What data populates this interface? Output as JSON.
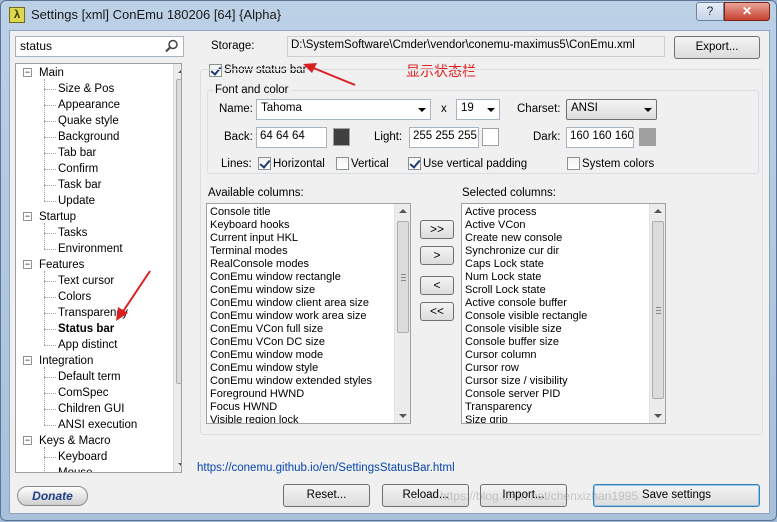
{
  "window": {
    "title": "Settings [xml] ConEmu 180206 [64] {Alpha}",
    "help_label": "?",
    "close_label": "✕"
  },
  "search": {
    "value": "status"
  },
  "tree": [
    {
      "label": "Main",
      "level": 0,
      "expander": "−"
    },
    {
      "label": "Size & Pos",
      "level": 1
    },
    {
      "label": "Appearance",
      "level": 1
    },
    {
      "label": "Quake style",
      "level": 1
    },
    {
      "label": "Background",
      "level": 1
    },
    {
      "label": "Tab bar",
      "level": 1
    },
    {
      "label": "Confirm",
      "level": 1
    },
    {
      "label": "Task bar",
      "level": 1
    },
    {
      "label": "Update",
      "level": 1
    },
    {
      "label": "Startup",
      "level": 0,
      "expander": "−"
    },
    {
      "label": "Tasks",
      "level": 1
    },
    {
      "label": "Environment",
      "level": 1
    },
    {
      "label": "Features",
      "level": 0,
      "expander": "−"
    },
    {
      "label": "Text cursor",
      "level": 1
    },
    {
      "label": "Colors",
      "level": 1
    },
    {
      "label": "Transparency",
      "level": 1
    },
    {
      "label": "Status bar",
      "level": 1,
      "selected": true
    },
    {
      "label": "App distinct",
      "level": 1
    },
    {
      "label": "Integration",
      "level": 0,
      "expander": "−"
    },
    {
      "label": "Default term",
      "level": 1
    },
    {
      "label": "ComSpec",
      "level": 1
    },
    {
      "label": "Children GUI",
      "level": 1
    },
    {
      "label": "ANSI execution",
      "level": 1
    },
    {
      "label": "Keys & Macro",
      "level": 0,
      "expander": "−"
    },
    {
      "label": "Keyboard",
      "level": 1
    },
    {
      "label": "Mouse",
      "level": 1
    }
  ],
  "storage": {
    "label": "Storage:",
    "path": "D:\\SystemSoftware\\Cmder\\vendor\\conemu-maximus5\\ConEmu.xml",
    "export_label": "Export..."
  },
  "status_bar": {
    "show_label": "Show status bar",
    "show_checked": true,
    "annotation": "显示状态栏"
  },
  "font_group": {
    "title": "Font and color",
    "name_label": "Name:",
    "name_value": "Tahoma",
    "x_label": "x",
    "size_value": "19",
    "charset_label": "Charset:",
    "charset_value": "ANSI",
    "back_label": "Back:",
    "back_value": "64 64 64",
    "back_color": "#404040",
    "light_label": "Light:",
    "light_value": "255 255 255",
    "light_color": "#ffffff",
    "dark_label": "Dark:",
    "dark_value": "160 160 160",
    "dark_color": "#a0a0a0",
    "lines_label": "Lines:",
    "horizontal_label": "Horizontal",
    "horizontal_checked": true,
    "vertical_label": "Vertical",
    "vertical_checked": false,
    "vpad_label": "Use vertical padding",
    "vpad_checked": true,
    "syscolors_label": "System colors",
    "syscolors_checked": false
  },
  "available": {
    "label": "Available columns:",
    "items": [
      "Console title",
      "Keyboard hooks",
      "Current input HKL",
      "Terminal modes",
      "RealConsole modes",
      "ConEmu window rectangle",
      "ConEmu window size",
      "ConEmu window client area size",
      "ConEmu window work area size",
      "ConEmu VCon full size",
      "ConEmu VCon DC size",
      "ConEmu window mode",
      "ConEmu window style",
      "ConEmu window extended styles",
      "Foreground HWND",
      "Focus HWND",
      "Visible region lock"
    ]
  },
  "selected": {
    "label": "Selected columns:",
    "items": [
      "Active process",
      "Active VCon",
      "Create new console",
      "Synchronize cur dir",
      "Caps Lock state",
      "Num Lock state",
      "Scroll Lock state",
      "Active console buffer",
      "Console visible rectangle",
      "Console visible size",
      "Console buffer size",
      "Cursor column",
      "Cursor row",
      "Cursor size / visibility",
      "Console server PID",
      "Transparency",
      "Size grip"
    ]
  },
  "move_buttons": {
    "add_all": ">>",
    "add": ">",
    "remove": "<",
    "remove_all": "<<"
  },
  "help_link": "https://conemu.github.io/en/SettingsStatusBar.html",
  "bottom": {
    "donate_label": "Donate",
    "reset_label": "Reset...",
    "reload_label": "Reload...",
    "import_label": "Import...",
    "save_label": "Save settings"
  },
  "watermark": "https://blog.csdn.net/chenxizhan1995"
}
